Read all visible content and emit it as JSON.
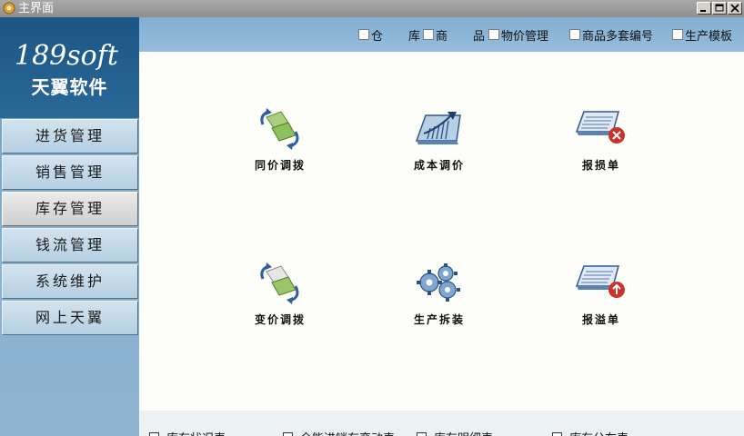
{
  "window": {
    "title": "主界面"
  },
  "logo": {
    "english": "189soft",
    "chinese": "天翼软件"
  },
  "menu": [
    {
      "label": "进货管理",
      "active": false
    },
    {
      "label": "销售管理",
      "active": false
    },
    {
      "label": "库存管理",
      "active": true
    },
    {
      "label": "钱流管理",
      "active": false
    },
    {
      "label": "系统维护",
      "active": false
    },
    {
      "label": "网上天翼",
      "active": false
    }
  ],
  "top_checks": [
    {
      "label": "仓",
      "checked": false
    },
    {
      "label": "库",
      "checked": false
    },
    {
      "label": "商",
      "checked": false
    },
    {
      "label": "品",
      "checked": false
    },
    {
      "label": "物价管理",
      "checked": false
    },
    {
      "label": "商品多套编号",
      "checked": false
    },
    {
      "label": "生产模板",
      "checked": false
    }
  ],
  "tools": [
    {
      "label": "同价调拨",
      "icon": "folder-swap-icon"
    },
    {
      "label": "成本调价",
      "icon": "chart-adjust-icon"
    },
    {
      "label": "报损单",
      "icon": "document-loss-icon"
    },
    {
      "label": "变价调拨",
      "icon": "folder-swap-icon"
    },
    {
      "label": "生产拆装",
      "icon": "gears-icon"
    },
    {
      "label": "报溢单",
      "icon": "document-overflow-icon"
    }
  ],
  "reports": [
    {
      "label": "库存状况表"
    },
    {
      "label": "全能进销存变动表"
    },
    {
      "label": "库存明细表"
    },
    {
      "label": "库存分布表"
    }
  ],
  "colors": {
    "panel": "#89b1d0",
    "logo_bg": "#1b5685",
    "accent_red": "#c8342a"
  }
}
